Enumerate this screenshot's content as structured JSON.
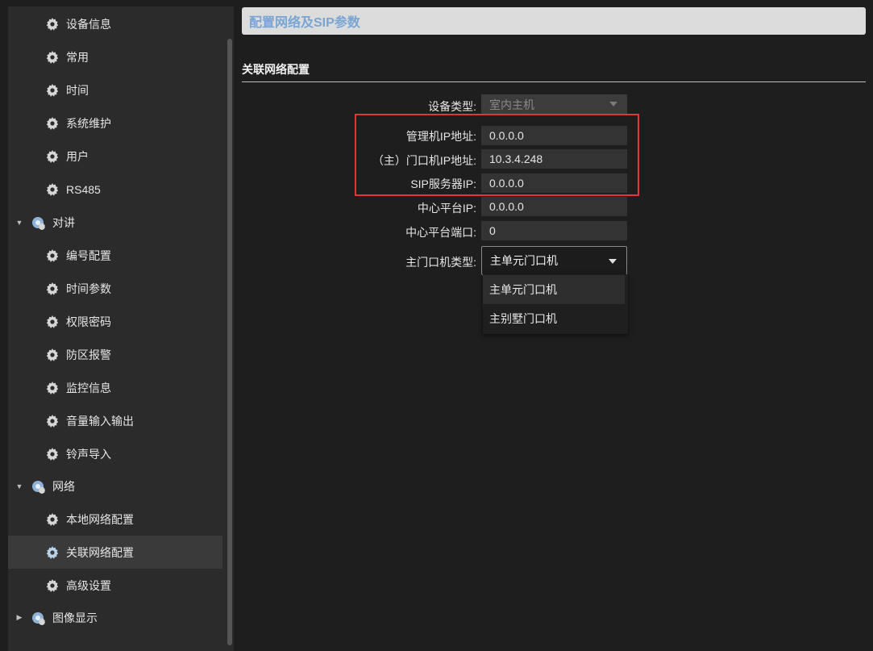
{
  "page_title": "配置网络及SIP参数",
  "section_title": "关联网络配置",
  "sidebar": {
    "items": [
      {
        "label": "设备信息",
        "type": "child"
      },
      {
        "label": "常用",
        "type": "child"
      },
      {
        "label": "时间",
        "type": "child"
      },
      {
        "label": "系统维护",
        "type": "child"
      },
      {
        "label": "用户",
        "type": "child"
      },
      {
        "label": "RS485",
        "type": "child"
      },
      {
        "label": "对讲",
        "type": "group",
        "expanded": true
      },
      {
        "label": "编号配置",
        "type": "child"
      },
      {
        "label": "时间参数",
        "type": "child"
      },
      {
        "label": "权限密码",
        "type": "child"
      },
      {
        "label": "防区报警",
        "type": "child"
      },
      {
        "label": "监控信息",
        "type": "child"
      },
      {
        "label": "音量输入输出",
        "type": "child"
      },
      {
        "label": "铃声导入",
        "type": "child"
      },
      {
        "label": "网络",
        "type": "group",
        "expanded": true
      },
      {
        "label": "本地网络配置",
        "type": "child"
      },
      {
        "label": "关联网络配置",
        "type": "child",
        "selected": true
      },
      {
        "label": "高级设置",
        "type": "child"
      },
      {
        "label": "图像显示",
        "type": "group",
        "expanded": false
      }
    ]
  },
  "form": {
    "device_type": {
      "label": "设备类型:",
      "value": "室内主机"
    },
    "mgmt_ip": {
      "label": "管理机IP地址:",
      "value": "0.0.0.0"
    },
    "door_ip": {
      "label": "（主）门口机IP地址:",
      "value": "10.3.4.248"
    },
    "sip_ip": {
      "label": "SIP服务器IP:",
      "value": "0.0.0.0"
    },
    "center_ip": {
      "label": "中心平台IP:",
      "value": "0.0.0.0"
    },
    "center_port": {
      "label": "中心平台端口:",
      "value": "0"
    },
    "door_type": {
      "label": "主门口机类型:",
      "value": "主单元门口机",
      "options": [
        "主单元门口机",
        "主别墅门口机"
      ]
    }
  },
  "colors": {
    "title_text": "#7aa5d2",
    "highlight_border": "#e0383a",
    "sidebar_bg": "#2b2b2b",
    "page_bg": "#1e1e1e"
  }
}
